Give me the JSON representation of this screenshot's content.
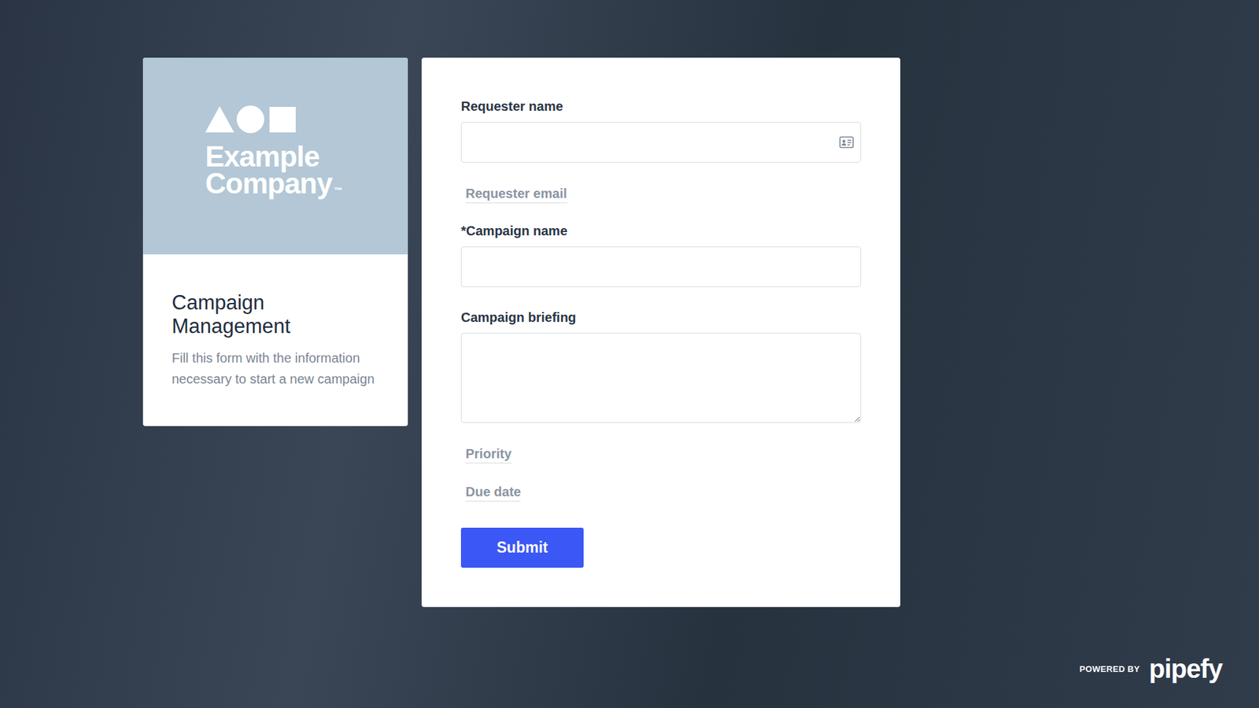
{
  "brand": {
    "line1": "Example",
    "line2": "Company",
    "trademark": "™"
  },
  "intro": {
    "title": "Campaign Management",
    "description": "Fill this form with the information necessary to start a new campaign"
  },
  "fields": [
    {
      "label": "Requester name",
      "kind": "contact"
    },
    {
      "label": "Requester email",
      "kind": "collapsed"
    },
    {
      "label": "*Campaign name",
      "kind": "input"
    },
    {
      "label": "Campaign briefing",
      "kind": "textarea"
    },
    {
      "label": "Priority",
      "kind": "collapsed"
    },
    {
      "label": "Due date",
      "kind": "collapsed"
    }
  ],
  "submit": "Submit",
  "footer": {
    "powered_by": "POWERED BY",
    "brand": "pipefy"
  }
}
